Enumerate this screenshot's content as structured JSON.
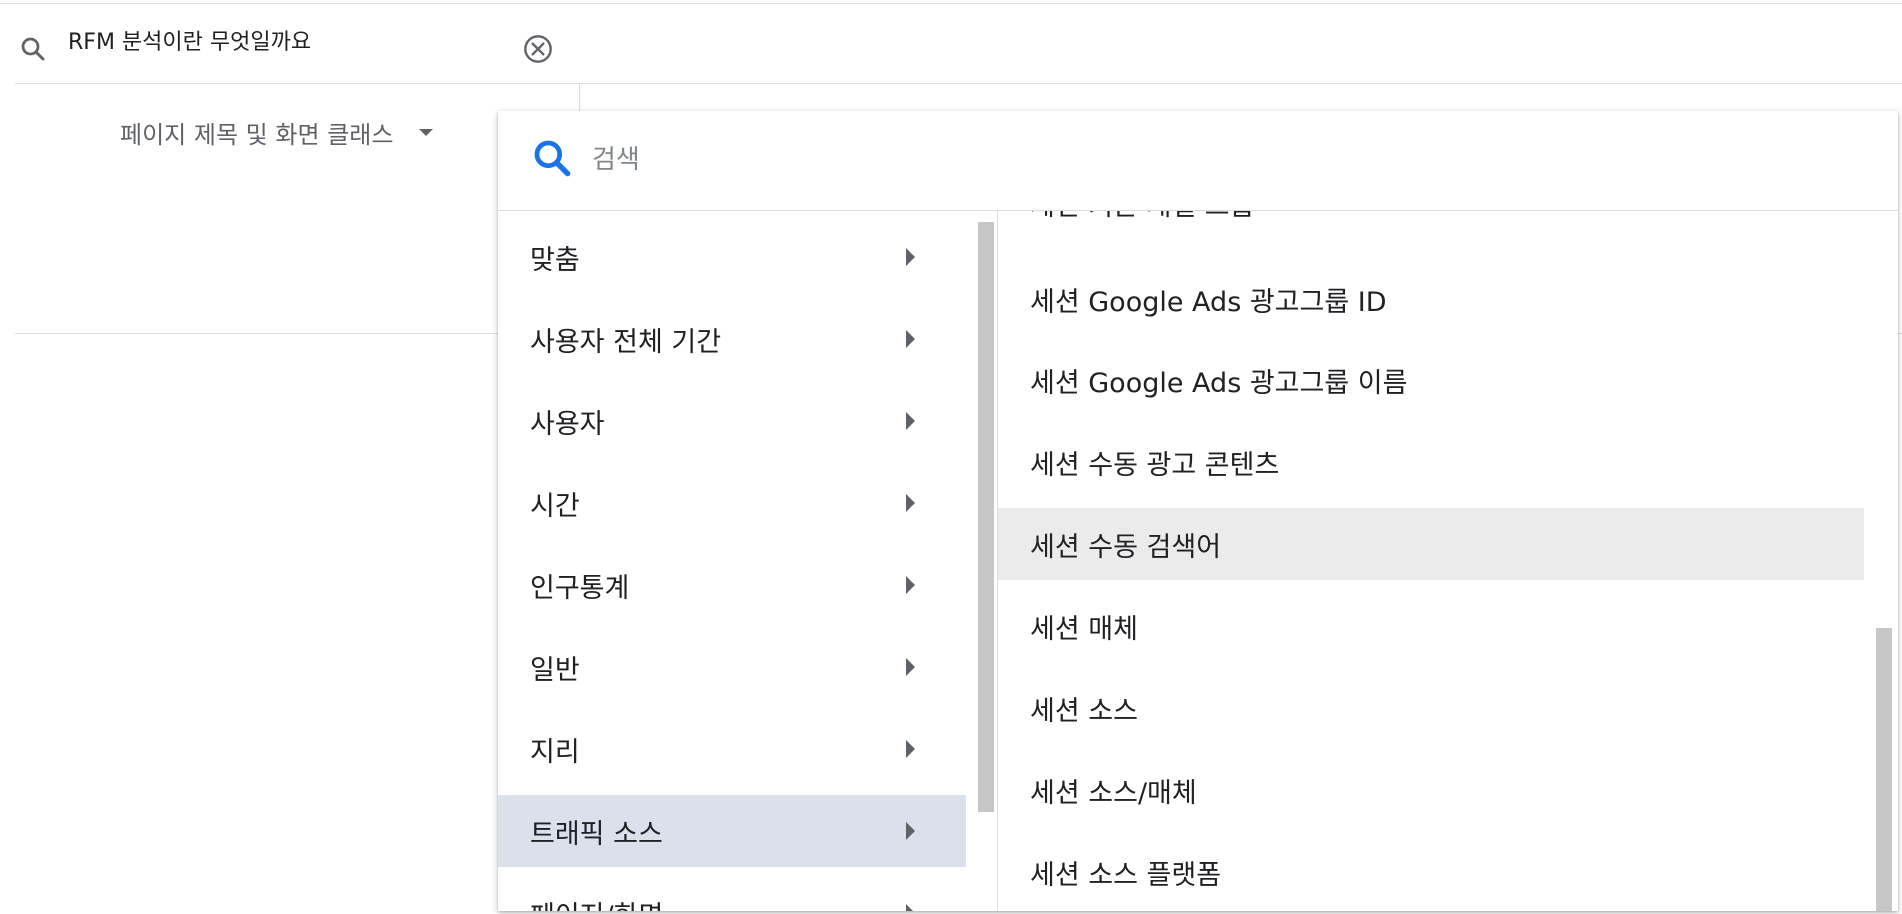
{
  "search": {
    "query": "RFM 분석이란 무엇일까요"
  },
  "dimension_selector": {
    "label": "페이지 제목 및 화면 클래스"
  },
  "dropdown": {
    "search_placeholder": "검색",
    "categories": [
      {
        "label": "맞춤"
      },
      {
        "label": "사용자 전체 기간"
      },
      {
        "label": "사용자"
      },
      {
        "label": "시간"
      },
      {
        "label": "인구통계"
      },
      {
        "label": "일반"
      },
      {
        "label": "지리"
      },
      {
        "label": "트래픽 소스",
        "selected": true
      },
      {
        "label": "페이지/화면"
      }
    ],
    "dimensions": [
      {
        "label": "세션 기본 채널 그룹"
      },
      {
        "label": "세션 Google Ads 광고그룹 ID"
      },
      {
        "label": "세션 Google Ads 광고그룹 이름"
      },
      {
        "label": "세션 수동 광고 콘텐츠"
      },
      {
        "label": "세션 수동 검색어",
        "hovered": true
      },
      {
        "label": "세션 매체"
      },
      {
        "label": "세션 소스"
      },
      {
        "label": "세션 소스/매체"
      },
      {
        "label": "세션 소스 플랫폼"
      }
    ]
  },
  "colors": {
    "selected_category_bg": "#dbe1ea",
    "hovered_item_bg": "#ebebeb",
    "search_icon_blue": "#1a73e8",
    "text_primary": "#202124",
    "text_secondary": "#5f6368"
  }
}
